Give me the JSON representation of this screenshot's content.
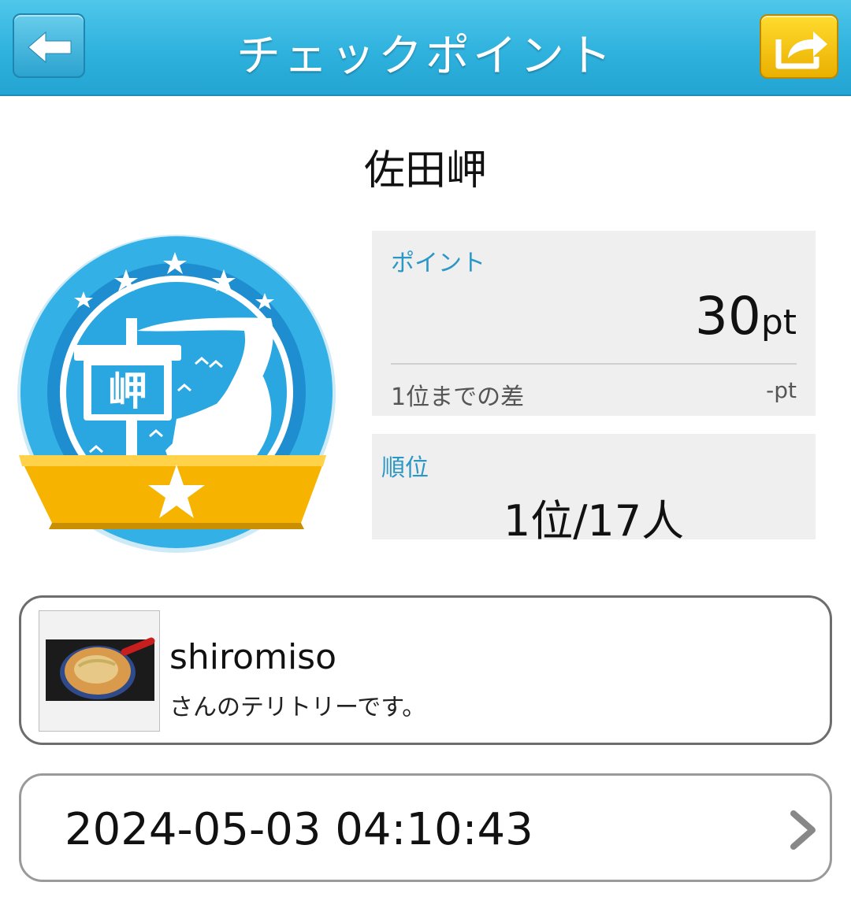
{
  "header": {
    "title": "チェックポイント",
    "back_icon": "back-arrow-icon",
    "share_icon": "share-icon"
  },
  "checkpoint": {
    "name": "佐田岬",
    "badge_kanji": "岬"
  },
  "points": {
    "label": "ポイント",
    "value": "30",
    "unit": "pt",
    "diff_label": "1位までの差",
    "diff_value": "-pt"
  },
  "rank": {
    "label": "順位",
    "value": "1位/17人"
  },
  "owner": {
    "name": "shiromiso",
    "note": "さんのテリトリーです。"
  },
  "timestamp": {
    "value": "2024-05-03 04:10:43"
  },
  "colors": {
    "header_blue": "#2fb2de",
    "badge_blue": "#2aa7e0",
    "badge_ribbon": "#f6b300",
    "label_blue": "#2a97c4",
    "panel_gray": "#efefef"
  }
}
